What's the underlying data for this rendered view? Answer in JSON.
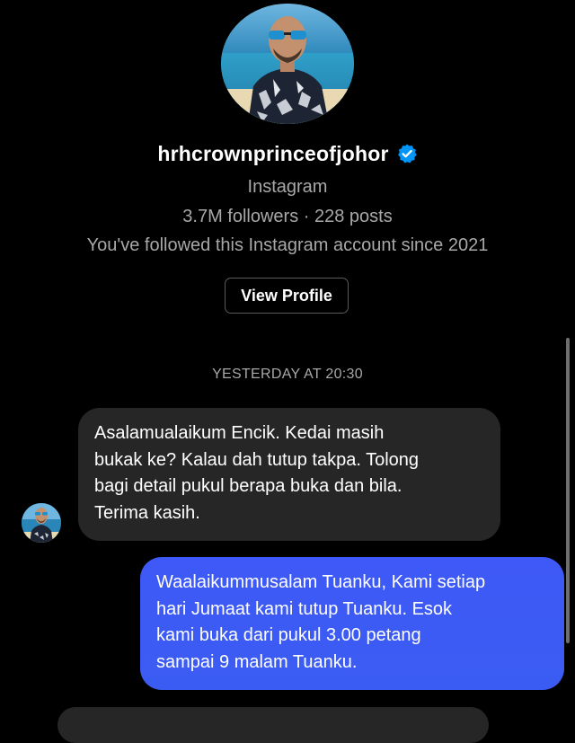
{
  "profile": {
    "username": "hrhcrownprinceofjohor",
    "verified": true,
    "platform": "Instagram",
    "stats": "3.7M followers · 228 posts",
    "follow_since": "You've followed this Instagram account since 2021",
    "view_profile_label": "View Profile"
  },
  "thread": {
    "timestamp": "YESTERDAY AT 20:30",
    "messages": [
      {
        "direction": "incoming",
        "text": "Asalamualaikum Encik. Kedai masih\nbukak ke? Kalau dah tutup takpa. Tolong\nbagi detail pukul berapa buka dan bila.\nTerima kasih."
      },
      {
        "direction": "outgoing",
        "text": "Waalaikummusalam Tuanku, Kami setiap\nhari Jumaat kami tutup Tuanku. Esok\nkami buka dari pukul 3.00 petang\nsampai 9 malam Tuanku."
      }
    ]
  },
  "colors": {
    "background": "#000000",
    "incoming_bubble": "#262626",
    "outgoing_bubble": "#3d5af6",
    "verified_badge": "#0095f6",
    "secondary_text": "#a8a8a8"
  },
  "icons": {
    "verified": "verified-badge-icon"
  }
}
